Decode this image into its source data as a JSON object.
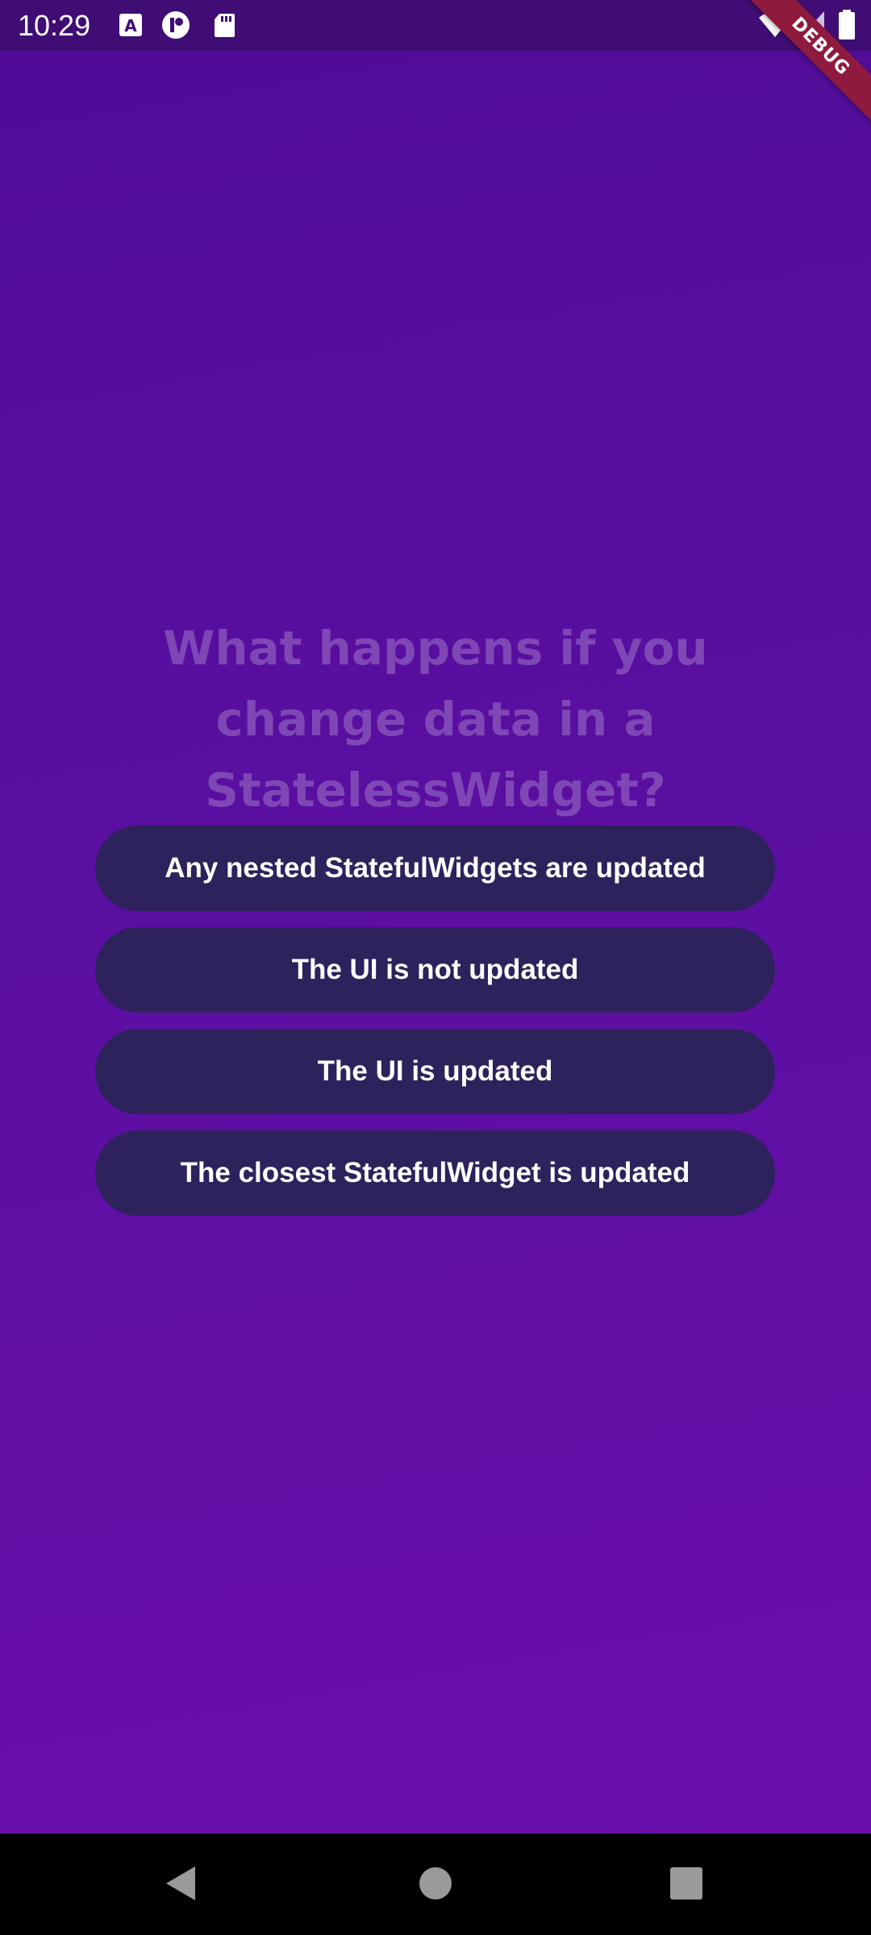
{
  "status_bar": {
    "time": "10:29",
    "left_icons": [
      "a-box-icon",
      "circle-p-icon",
      "sd-card-icon"
    ],
    "right_icons": [
      "wifi-icon",
      "signal-icon",
      "battery-icon"
    ]
  },
  "debug_banner": {
    "label": "DEBUG",
    "color": "#8e1a3d"
  },
  "quiz": {
    "question": "What happens if you change data in a StatelessWidget?",
    "answers": [
      "Any nested StatefulWidgets are updated",
      "The UI is not updated",
      "The UI is updated",
      "The closest StatefulWidget is updated"
    ]
  },
  "colors": {
    "background_top": "#4f0c97",
    "background_bottom": "#6a0fab",
    "answer_button": "#2d225c",
    "question_text": "#7e47b5"
  },
  "nav_bar": {
    "buttons": [
      "back-icon",
      "home-icon",
      "recents-icon"
    ]
  }
}
